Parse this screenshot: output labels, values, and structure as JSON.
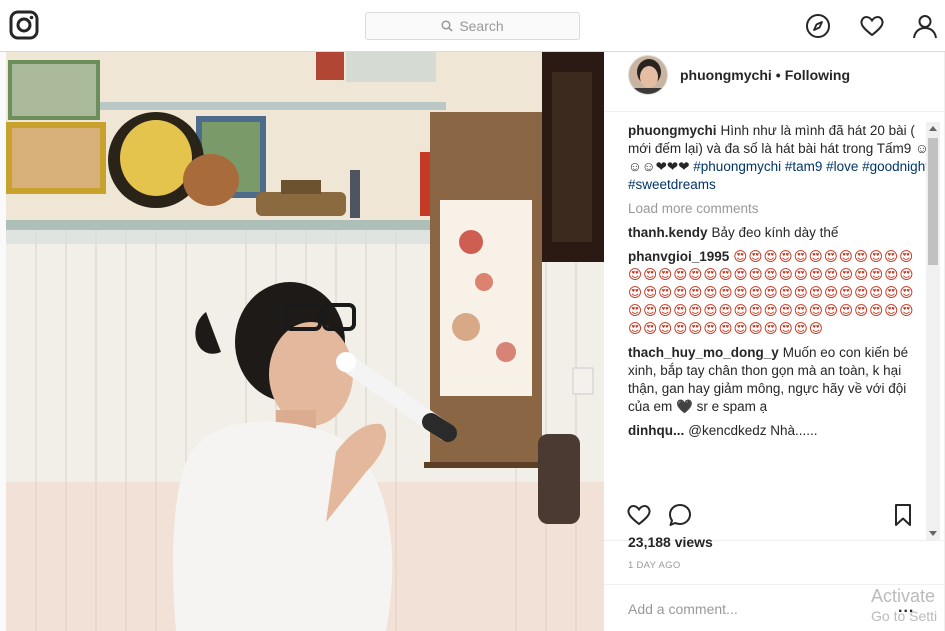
{
  "search": {
    "placeholder": "Search"
  },
  "post": {
    "username": "phuongmychi",
    "dot": "•",
    "follow_status": "Following",
    "caption_user": "phuongmychi",
    "caption_text": "Hình như là mình đã hát 20 bài ( mới đếm lại) và đa số là hát bài hát trong Tấm9 ☺☺☺❤❤❤",
    "caption_tags": "#phuongmychi #tam9 #love #goodnight #sweetdreams",
    "load_more": "Load more comments",
    "comments": [
      {
        "user": "thanh.kendy",
        "text": "Bảy đeo kính dày thế"
      },
      {
        "user": "phanvgioi_1995",
        "text": "😍😍😍😍😍😍😍😍😍😍😍😍😍😍😍😍😍😍😍😍😍😍😍😍😍😍😍😍😍😍😍😍😍😍😍😍😍😍😍😍😍😍😍😍😍😍😍😍😍😍😍😍😍😍😍😍😍😍😍😍😍😍😍😍😍😍😍😍😍😍😍😍😍😍😍😍😍😍😍😍😍😍"
      },
      {
        "user": "thach_huy_mo_dong_y",
        "text": "Muốn eo con kiến bé xinh, bắp tay chân thon gọn mà an toàn, k hại thận, gan hay giảm mông, ngực hãy về với đội của em 🖤 sr e spam ạ"
      },
      {
        "user": "dinhqu...",
        "text": "@kencdkedz Nhà......"
      }
    ],
    "views": "23,188 views",
    "time_ago": "1 DAY AGO",
    "add_comment_placeholder": "Add a comment...",
    "more_label": "..."
  },
  "watermark": {
    "line1": "Activate",
    "line2": "Go to Setti"
  },
  "colors": {
    "accent": "#003569",
    "border": "#dbdbdb",
    "muted": "#999999"
  },
  "icons": [
    "instagram-logo-icon",
    "search-icon",
    "explore-compass-icon",
    "heart-icon",
    "profile-icon",
    "like-heart-icon",
    "comment-bubble-icon",
    "bookmark-icon",
    "more-options-icon"
  ]
}
